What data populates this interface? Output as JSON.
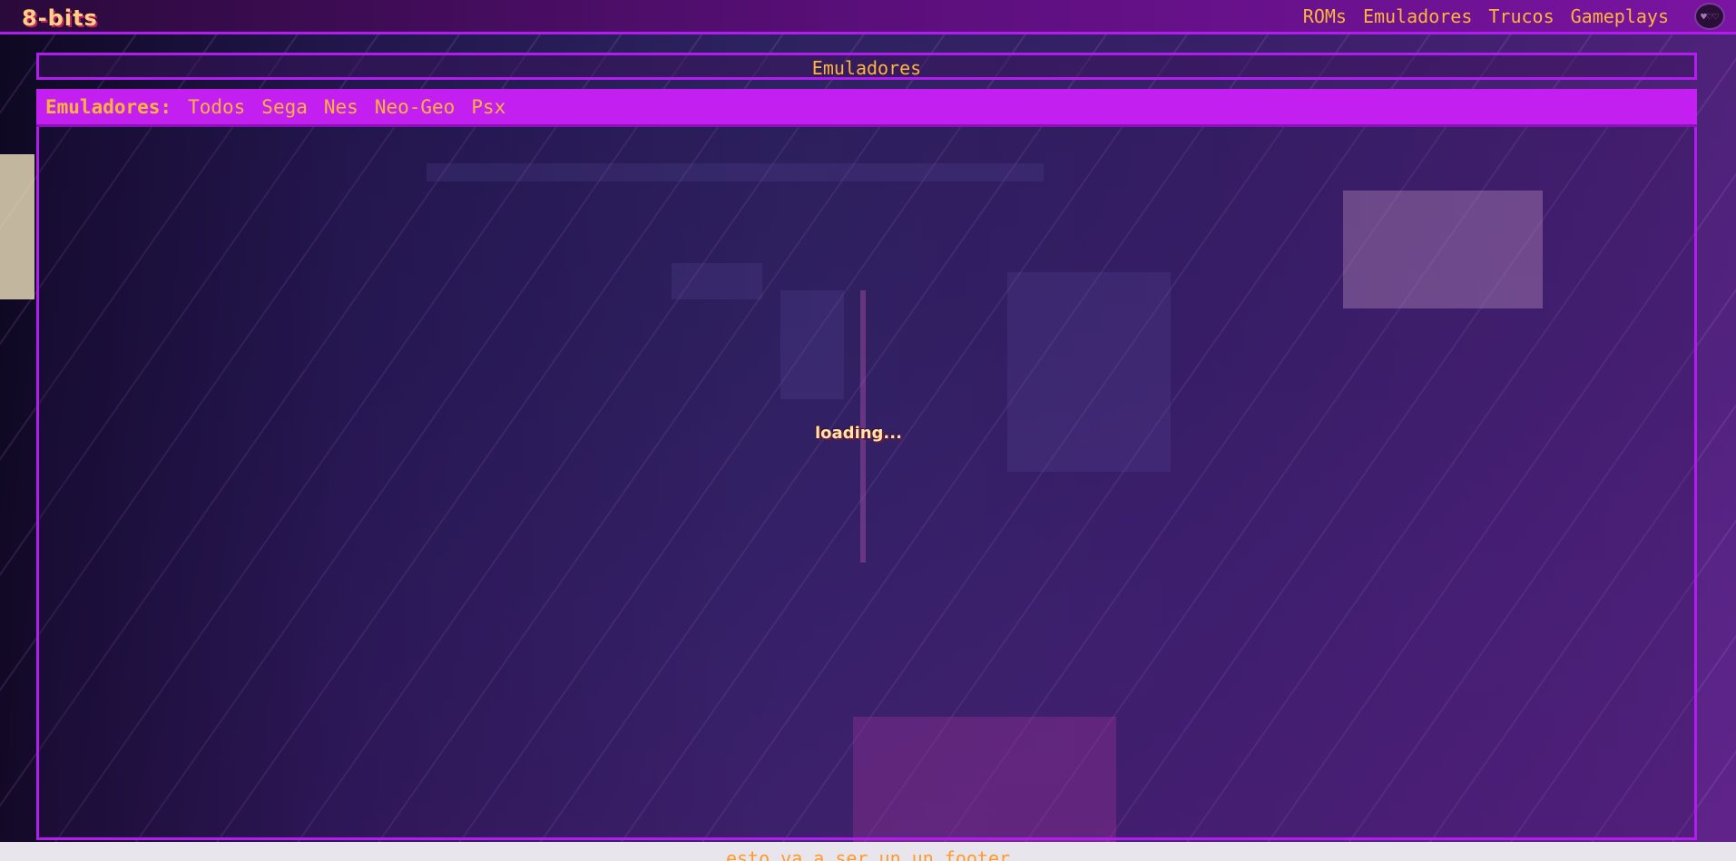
{
  "header": {
    "logo": "8-bits",
    "nav": [
      {
        "label": "ROMs"
      },
      {
        "label": "Emuladores"
      },
      {
        "label": "Trucos"
      },
      {
        "label": "Gameplays"
      }
    ],
    "avatar_icon": "avatar-icon"
  },
  "title": {
    "text": "Emuladores"
  },
  "filters": {
    "label": "Emuladores:",
    "items": [
      {
        "label": "Todos"
      },
      {
        "label": "Sega"
      },
      {
        "label": "Nes"
      },
      {
        "label": "Neo-Geo"
      },
      {
        "label": "Psx"
      }
    ]
  },
  "content": {
    "loading_text": "loading..."
  },
  "footer": {
    "text": "esto va a ser un un footer"
  },
  "colors": {
    "accent": "#b21cf0",
    "text_orange": "#ffb43a",
    "filter_bg": "#c21ff0"
  }
}
